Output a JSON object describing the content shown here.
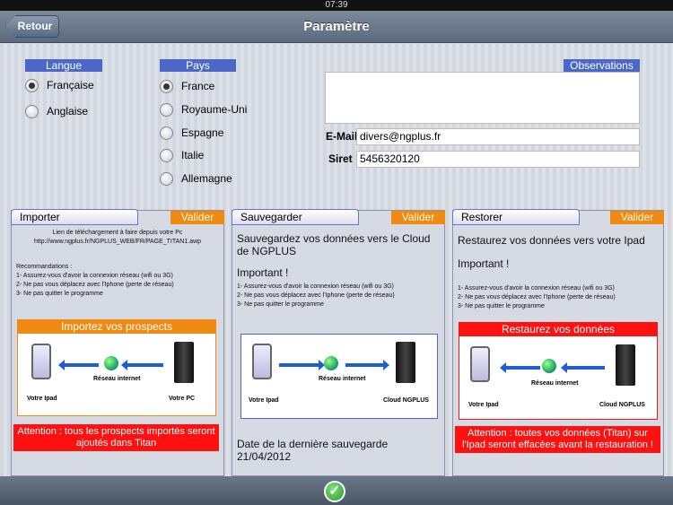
{
  "status_time": "07:39",
  "nav": {
    "back": "Retour",
    "title": "Paramètre"
  },
  "langue": {
    "label": "Langue",
    "options": [
      "Française",
      "Anglaise"
    ],
    "selected": 0
  },
  "pays": {
    "label": "Pays",
    "options": [
      "France",
      "Royaume-Uni",
      "Espagne",
      "Italie",
      "Allemagne"
    ],
    "selected": 0
  },
  "observations": {
    "label": "Observations",
    "value": ""
  },
  "email": {
    "label": "E-Mail",
    "value": "divers@ngplus.fr"
  },
  "siret": {
    "label": "Siret",
    "value": "5456320120"
  },
  "panels": [
    {
      "tab": "Importer",
      "valider": "Valider",
      "intro": "Lien de téléchargement à faire depuis votre Pc http://www.ngplus.fr/NGPLUS_WEB/FR/PAGE_TITAN1.awp",
      "reco_title": "Recommandations :",
      "lines": [
        "1- Assurez-vous d'avoir la connexion réseau (wifi ou 3G)",
        "2- Ne pas vous déplacez avec l'Iphone (perte de réseau)",
        "3- Ne pas quitter le programme"
      ],
      "fig_title": "Importez vos prospects",
      "cap_left": "Votre Ipad",
      "cap_mid": "Réseau internet",
      "cap_right": "Votre PC",
      "warning": "Attention : tous les prospects importés seront ajoutés dans Titan"
    },
    {
      "tab": "Sauvegarder",
      "valider": "Valider",
      "intro": "Sauvegardez vos données vers le Cloud de NGPLUS",
      "reco_title": "Important !",
      "lines": [
        "1- Assurez-vous d'avoir la connexion réseau (wifi ou 3G)",
        "2- Ne pas vous déplacez avec l'Iphone (perte de réseau)",
        "3- Ne pas quitter le programme"
      ],
      "cap_left": "Votre Ipad",
      "cap_mid": "Réseau internet",
      "cap_right": "Cloud NGPLUS",
      "last_save": "Date de la dernière sauvegarde 21/04/2012"
    },
    {
      "tab": "Restorer",
      "valider": "Valider",
      "intro": "Restaurez vos données vers votre Ipad",
      "reco_title": "Important !",
      "lines": [
        "1- Assurez-vous d'avoir la connexion réseau (wifi ou 3G)",
        "2- Ne pas vous déplacez avec l'Iphone (perte de réseau)",
        "3- Ne pas quitter le programme"
      ],
      "fig_title": "Restaurez vos données",
      "cap_left": "Votre Ipad",
      "cap_mid": "Réseau internet",
      "cap_right": "Cloud NGPLUS",
      "warning": "Attention : toutes vos données (Titan) sur l'Ipad seront effacées avant la restauration !"
    }
  ],
  "icons": {
    "confirm": "check-icon",
    "globe": "globe-icon",
    "device": "tablet-icon",
    "server": "server-icon"
  },
  "colors": {
    "accent": "#4b67c7",
    "valider": "#f08a14",
    "warning": "#ff1111",
    "check": "#2b9a2b"
  }
}
